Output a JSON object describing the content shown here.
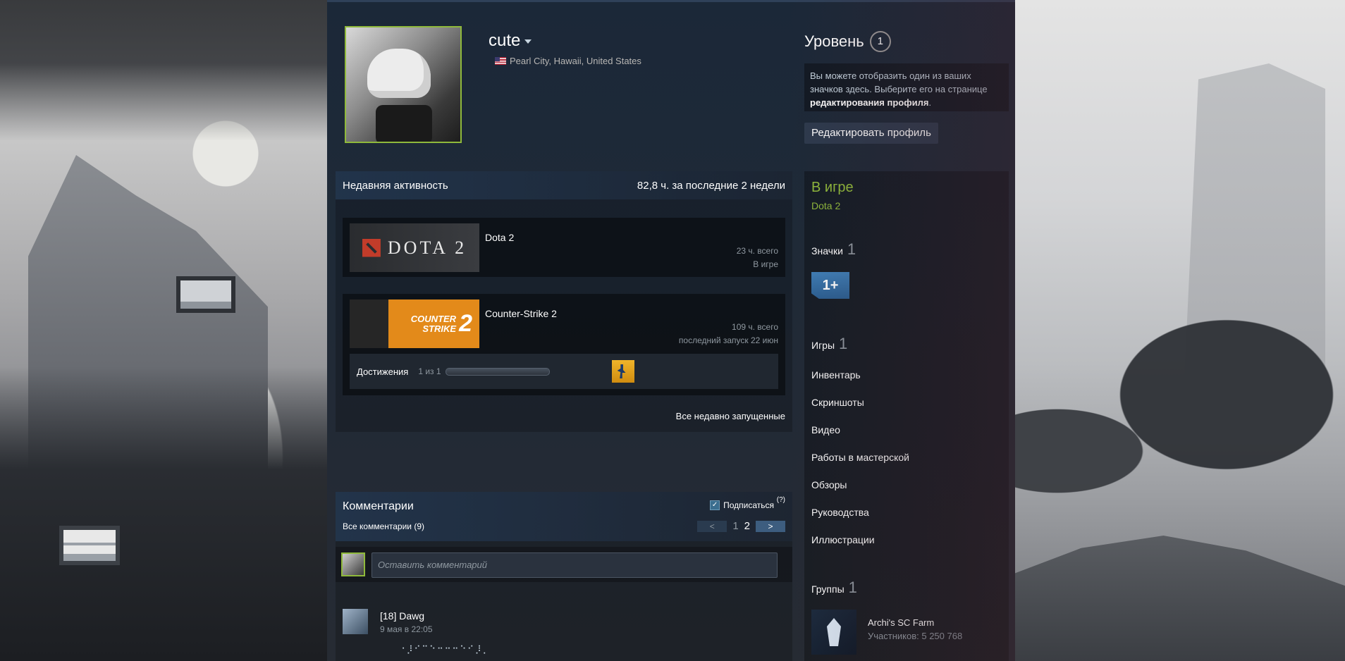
{
  "profile": {
    "name": "cute",
    "location": "Pearl City, Hawaii, United States",
    "level_label": "Уровень",
    "level_value": "1",
    "badge_note_prefix": "Вы можете отобразить один из ваших значков здесь. Выберите его на странице ",
    "badge_note_link": "редактирования профиля",
    "badge_note_suffix": ".",
    "edit_button": "Редактировать профиль"
  },
  "activity": {
    "title": "Недавняя активность",
    "summary": "82,8 ч. за последние 2 недели",
    "games": [
      {
        "title": "Dota 2",
        "logo_text": "DOTA 2",
        "hours": "23 ч. всего",
        "status": "В игре"
      },
      {
        "title": "Counter-Strike 2",
        "logo_text_1": "COUNTER",
        "logo_text_2": "STRIKE",
        "logo_num": "2",
        "hours": "109 ч. всего",
        "status": "последний запуск 22 июн",
        "achievements_label": "Достижения",
        "achievements_count": "1 из 1",
        "achievements_progress": 1.0
      }
    ],
    "all_recent": "Все недавно запущенные"
  },
  "comments": {
    "title": "Комментарии",
    "all": "Все комментарии (9)",
    "subscribe": "Подписаться",
    "help": "(?)",
    "pager_prev": "<",
    "pager_next": ">",
    "pages": [
      "1",
      "2"
    ],
    "placeholder": "Оставить комментарий",
    "items": [
      {
        "author": "[18] Dawg",
        "time": "9 мая в 22:05",
        "text": "⠐⡸⠊⠉⠑⠒⠒⠒⠑⠊⡸⡀"
      }
    ]
  },
  "sidebar": {
    "ingame_label": "В игре",
    "ingame_game": "Dota 2",
    "badges_label": "Значки",
    "badges_count": "1",
    "badge_text": "1+",
    "games_label": "Игры",
    "games_count": "1",
    "links": [
      "Инвентарь",
      "Скриншоты",
      "Видео",
      "Работы в мастерской",
      "Обзоры",
      "Руководства",
      "Иллюстрации"
    ],
    "groups_label": "Группы",
    "groups_count": "1",
    "group_name": "Archi's SC Farm",
    "group_members": "Участников: 5 250 768"
  },
  "colors": {
    "ingame_green": "#90ba3c",
    "accent_blue": "#3d5d7f",
    "avatar_border": "#8fb93b"
  }
}
